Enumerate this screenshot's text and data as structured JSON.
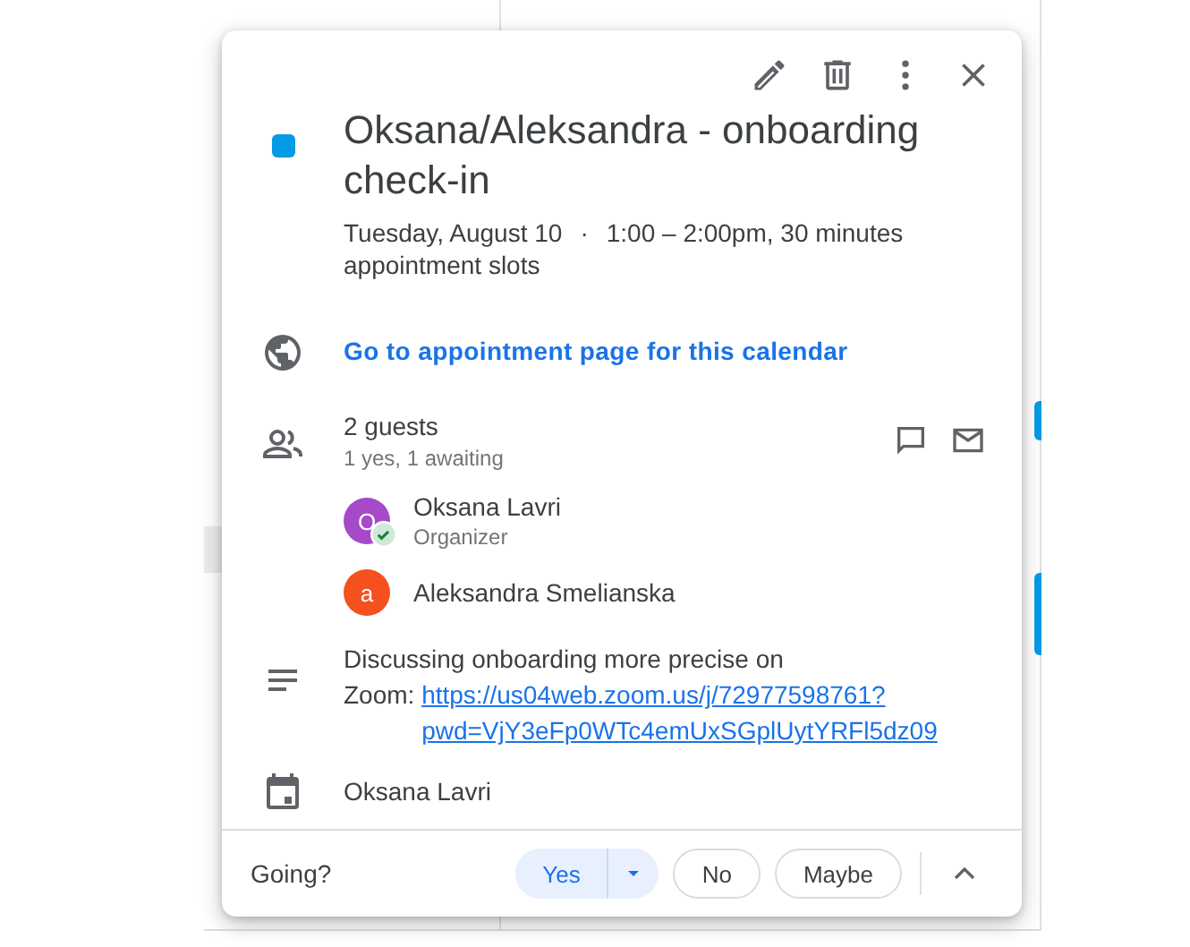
{
  "event": {
    "title": "Oksana/Aleksandra - onboarding check-in",
    "date": "Tuesday, August 10",
    "separator": "·",
    "time": "1:00 – 2:00pm, 30 minutes",
    "subtitle": "appointment slots"
  },
  "appointment_link": "Go to appointment page for this calendar",
  "guests": {
    "count": "2 guests",
    "summary": "1 yes, 1 awaiting",
    "people": [
      {
        "initial": "O",
        "name": "Oksana Lavri",
        "role": "Organizer",
        "color": "#a64ac9",
        "accepted": true
      },
      {
        "initial": "a",
        "name": "Aleksandra Smelianska",
        "color": "#f4511e",
        "accepted": false
      }
    ]
  },
  "description": {
    "text": "Discussing onboarding more precise on",
    "link_prefix": "Zoom:",
    "link": "https://us04web.zoom.us/j/72977598761?pwd=VjY3eFp0WTc4emUxSGplUytYRFl5dz09"
  },
  "calendar": "Oksana Lavri",
  "footer": {
    "label": "Going?",
    "responses": [
      {
        "label": "Yes",
        "selected": true
      },
      {
        "label": "No",
        "selected": false
      },
      {
        "label": "Maybe",
        "selected": false
      }
    ]
  }
}
